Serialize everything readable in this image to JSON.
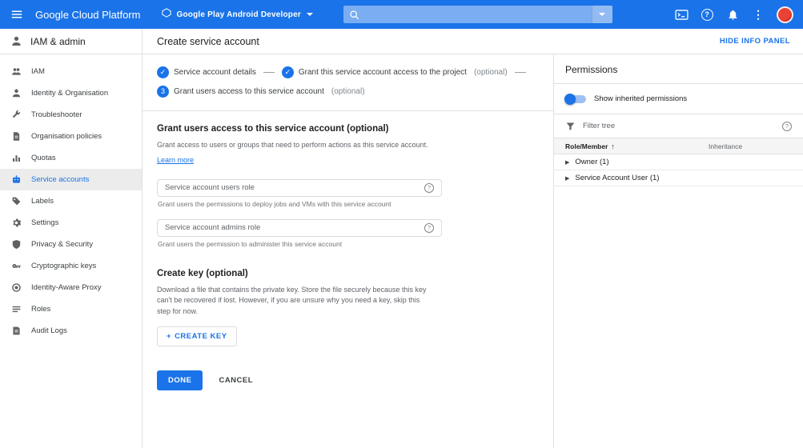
{
  "icons": {
    "help": "?",
    "more": "⋮",
    "check": "✓",
    "plus": "+",
    "sort_up": "↑",
    "expand": "▶"
  },
  "colors": {
    "topbar_blue": "#1a73e8",
    "accent_blue": "#1a73e8",
    "avatar_red": "#ea4335"
  },
  "topbar": {
    "brand": "Google Cloud Platform",
    "project": "Google Play Android Developer",
    "search_placeholder": ""
  },
  "sidebar": {
    "title": "IAM & admin",
    "items": [
      {
        "label": "IAM",
        "icon": "people-icon",
        "active": false
      },
      {
        "label": "Identity & Organisation",
        "icon": "person-icon",
        "active": false
      },
      {
        "label": "Troubleshooter",
        "icon": "wrench-icon",
        "active": false
      },
      {
        "label": "Organisation policies",
        "icon": "document-icon",
        "active": false
      },
      {
        "label": "Quotas",
        "icon": "bar-chart-icon",
        "active": false
      },
      {
        "label": "Service accounts",
        "icon": "robot-icon",
        "active": true
      },
      {
        "label": "Labels",
        "icon": "tag-icon",
        "active": false
      },
      {
        "label": "Settings",
        "icon": "gear-icon",
        "active": false
      },
      {
        "label": "Privacy & Security",
        "icon": "shield-icon",
        "active": false
      },
      {
        "label": "Cryptographic keys",
        "icon": "key-icon",
        "active": false
      },
      {
        "label": "Identity-Aware Proxy",
        "icon": "target-icon",
        "active": false
      },
      {
        "label": "Roles",
        "icon": "list-icon",
        "active": false
      },
      {
        "label": "Audit Logs",
        "icon": "file-icon",
        "active": false
      }
    ]
  },
  "page": {
    "title": "Create service account",
    "hide_info_panel": "HIDE INFO PANEL"
  },
  "stepper": {
    "steps": [
      {
        "label": "Service account details",
        "optional": "",
        "state": "done"
      },
      {
        "label": "Grant this service account access to the project",
        "optional": "(optional)",
        "state": "done"
      },
      {
        "label": "Grant users access to this service account",
        "optional": "(optional)",
        "state": "current",
        "number": "3"
      }
    ]
  },
  "main": {
    "grant_users": {
      "heading": "Grant users access to this service account (optional)",
      "description": "Grant access to users or groups that need to perform actions as this service account.",
      "learn_more": "Learn more",
      "fields": [
        {
          "placeholder": "Service account users role",
          "helper": "Grant users the permissions to deploy jobs and VMs with this service account"
        },
        {
          "placeholder": "Service account admins role",
          "helper": "Grant users the permission to administer this service account"
        }
      ]
    },
    "create_key": {
      "heading": "Create key (optional)",
      "description": "Download a file that contains the private key. Store the file securely because this key can't be recovered if lost. However, if you are unsure why you need a key, skip this step for now.",
      "button": "CREATE KEY"
    },
    "actions": {
      "done": "DONE",
      "cancel": "CANCEL"
    }
  },
  "info_panel": {
    "title": "Permissions",
    "toggle_label": "Show inherited permissions",
    "filter_placeholder": "Filter tree",
    "table": {
      "col_role": "Role/Member",
      "col_inheritance": "Inheritance",
      "rows": [
        {
          "label": "Owner (1)"
        },
        {
          "label": "Service Account User (1)"
        }
      ]
    }
  }
}
